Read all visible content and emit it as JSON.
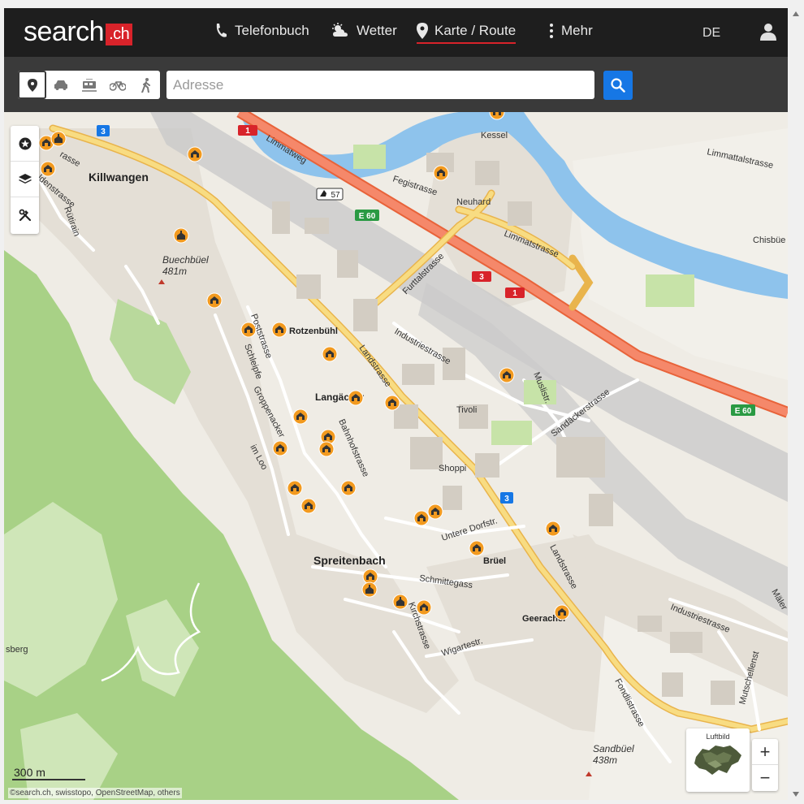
{
  "header": {
    "logo_text": "search",
    "logo_suffix": ".ch",
    "nav": [
      {
        "label": "Telefonbuch",
        "icon": "phone-icon"
      },
      {
        "label": "Wetter",
        "icon": "weather-icon"
      },
      {
        "label": "Karte / Route",
        "icon": "map-pin-icon"
      },
      {
        "label": "Mehr",
        "icon": "more-vertical-icon"
      }
    ],
    "language": "DE"
  },
  "search": {
    "placeholder": "Adresse",
    "modes": [
      "map-pin-icon",
      "car-icon",
      "train-icon",
      "bicycle-icon",
      "walk-icon"
    ]
  },
  "map": {
    "towns": {
      "killwangen": "Killwangen",
      "spreitenbach": "Spreitenbach",
      "kessel": "Kessel",
      "neuhard": "Neuhard",
      "rotzenbuehl": "Rotzenbühl",
      "langaecher": "Langäcker",
      "tivoli": "Tivoli",
      "shoppi": "Shoppi",
      "brueel": "Brüel",
      "geeracher": "Geeracher",
      "chisbuel": "Chisbüe",
      "berg": "sberg",
      "maler": "Mäler"
    },
    "peaks": {
      "buechbuel_name": "Buechbüel",
      "buechbuel_alt": "481m",
      "sandbuel_name": "Sandbüel",
      "sandbuel_alt": "438m"
    },
    "streets": {
      "limmatweg": "Limmatweg",
      "fegistrasse": "Fegistrasse",
      "limmattalstrasse": "Limmattalstrasse",
      "limmatstrasse": "Limmatstrasse",
      "furttalstrasse": "Furttalstrasse",
      "industriestrasse": "Industriestrasse",
      "industriestrasse2": "Industriestrasse",
      "landstrasse": "Landstrasse",
      "landstrasse2": "Landstrasse",
      "muslistr": "Muslistr.",
      "sandaeckerstrasse": "Sandäckerstrasse",
      "poststrasse": "Poststrasse",
      "schleipfe": "Schleipfe",
      "groppenacker": "Groppenacker",
      "imloo": "im Loo",
      "bahnhofstrasse": "Bahnhofstrasse",
      "untere_dorfstr": "Untere Dorfstr.",
      "schmittegass": "Schmittegass",
      "kirchstrasse": "Kirchstrasse",
      "wigartestr": "Wigartestr.",
      "fondlistrasse": "Fondlistrasse",
      "mutschellenstr": "Mutschellenst",
      "ruetirain": "Rütirain",
      "haldenstrasse": "aldenstrasse",
      "strasse_tl": "rasse"
    },
    "route_shields": {
      "r1": "1",
      "r1b": "1",
      "r3": "3",
      "r3b": "3",
      "r3c": "3",
      "r3d": "3",
      "e60": "E 60",
      "e60b": "E 60",
      "exit": "57"
    },
    "scale": "300 m",
    "attribution": "©search.ch, swisstopo, OpenStreetMap, others",
    "luftbild_label": "Luftbild",
    "zoom_in": "+",
    "zoom_out": "−"
  },
  "colors": {
    "header_bg": "#1e1e1e",
    "accent": "#d8232a",
    "search_button": "#1677e5",
    "motorway": "#f07a4d",
    "main_road": "#f7d870",
    "water": "#8ec3ec",
    "forest": "#a8d186",
    "poi": "#f29a1f"
  }
}
